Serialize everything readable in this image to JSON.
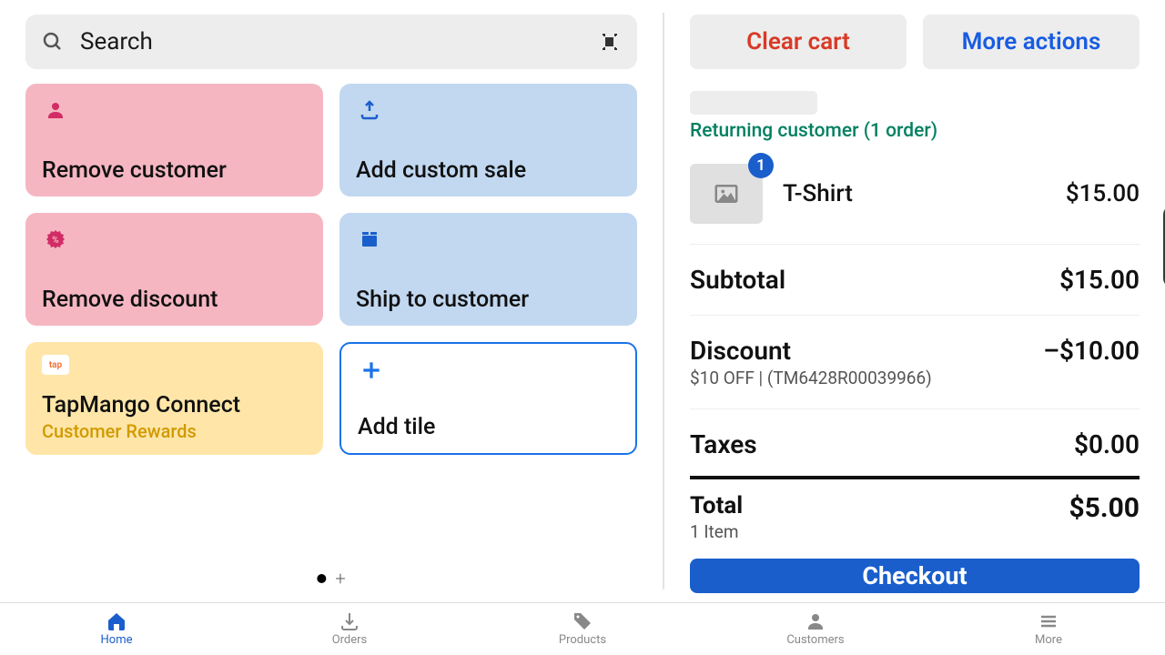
{
  "search": {
    "placeholder": "Search"
  },
  "tiles": {
    "remove_customer": "Remove customer",
    "add_custom_sale": "Add custom sale",
    "remove_discount": "Remove discount",
    "ship_to_customer": "Ship to customer",
    "tapmango": {
      "label": "TapMango Connect",
      "sub": "Customer Rewards",
      "badge": "tap"
    },
    "add_tile": "Add tile"
  },
  "right": {
    "clear_cart": "Clear cart",
    "more_actions": "More actions",
    "customer_status": "Returning customer (1 order)",
    "item": {
      "qty": "1",
      "name": "T-Shirt",
      "price": "$15.00"
    },
    "subtotal": {
      "label": "Subtotal",
      "value": "$15.00"
    },
    "discount": {
      "label": "Discount",
      "detail": "$10 OFF | (TM6428R00039966)",
      "value": "–$10.00"
    },
    "taxes": {
      "label": "Taxes",
      "value": "$0.00"
    },
    "total": {
      "label": "Total",
      "sub": "1 Item",
      "value": "$5.00"
    },
    "checkout": "Checkout"
  },
  "nav": {
    "home": "Home",
    "orders": "Orders",
    "products": "Products",
    "customers": "Customers",
    "more": "More"
  }
}
